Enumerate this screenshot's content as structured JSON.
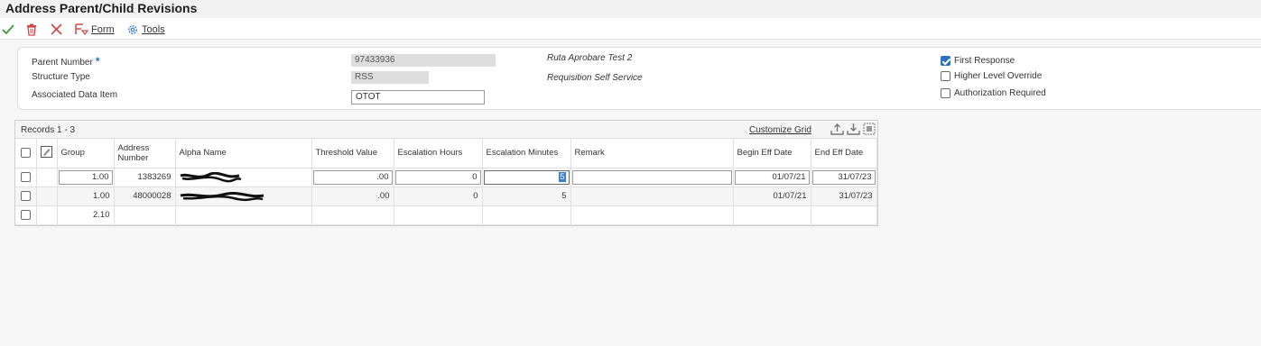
{
  "title": "Address Parent/Child Revisions",
  "toolbar": {
    "form_label": "Form",
    "tools_label": "Tools"
  },
  "header": {
    "parent_number_label": "Parent Number",
    "parent_number_value": "97433936",
    "parent_number_desc": "Ruta Aprobare Test 2",
    "structure_type_label": "Structure Type",
    "structure_type_value": "RSS",
    "structure_type_desc": "Requisition Self Service",
    "associated_item_label": "Associated Data Item",
    "associated_item_value": "OTOT",
    "checkboxes": [
      {
        "label": "First Response",
        "checked": true
      },
      {
        "label": "Higher Level Override",
        "checked": false
      },
      {
        "label": "Authorization Required",
        "checked": false
      }
    ]
  },
  "grid": {
    "records_label": "Records 1 - 3",
    "customize_label": "Customize Grid",
    "columns": [
      "Group",
      "Address Number",
      "Alpha Name",
      "Threshold Value",
      "Escalation Hours",
      "Escalation Minutes",
      "Remark",
      "Begin Eff Date",
      "End Eff Date"
    ],
    "rows": [
      {
        "group": "1.00",
        "address_number": "1383269",
        "alpha_name": "",
        "threshold": ".00",
        "esc_hours": "0",
        "esc_minutes": "5",
        "remark": "",
        "begin": "01/07/21",
        "end": "31/07/23"
      },
      {
        "group": "1.00",
        "address_number": "48000028",
        "alpha_name": "",
        "threshold": ".00",
        "esc_hours": "0",
        "esc_minutes": "5",
        "remark": "",
        "begin": "01/07/21",
        "end": "31/07/23"
      },
      {
        "group": "2.10",
        "address_number": "",
        "alpha_name": "",
        "threshold": "",
        "esc_hours": "",
        "esc_minutes": "",
        "remark": "",
        "begin": "",
        "end": ""
      }
    ]
  },
  "colors": {
    "accent_blue": "#1e6fd9",
    "ok_green": "#3c9a3c",
    "cancel_red": "#d64545"
  },
  "icons": [
    "ok-check-icon",
    "delete-trash-icon",
    "cancel-x-icon",
    "form-icon",
    "tools-gear-icon",
    "export-icon",
    "import-icon",
    "grid-settings-icon",
    "row-edit-icon"
  ]
}
